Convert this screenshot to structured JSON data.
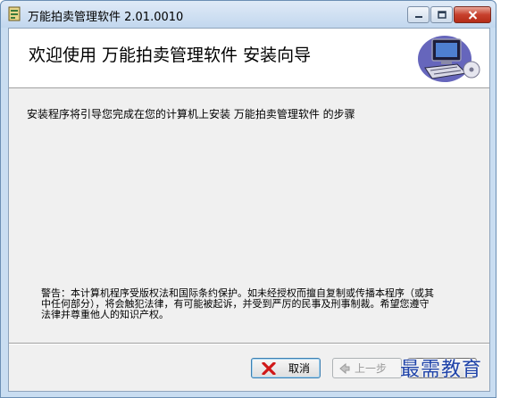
{
  "window": {
    "title": "万能拍卖管理软件 2.01.0010"
  },
  "banner": {
    "title": "欢迎使用 万能拍卖管理软件 安装向导",
    "graphic_icon": "computer-install-icon"
  },
  "body": {
    "intro": "安装程序将引导您完成在您的计算机上安装 万能拍卖管理软件 的步骤",
    "warning_lines": [
      "警告：本计算机程序受版权法和国际条约保护。如未经授权而擅自复制或传播本程序（或其",
      "中任何部分），将会触犯法律，有可能被起诉，并受到严厉的民事及刑事制裁。希望您遵守",
      "法律并尊重他人的知识产权。"
    ]
  },
  "buttons": {
    "cancel_label": "取消",
    "back_label": "上一步"
  },
  "watermark": "最需教育",
  "colors": {
    "title_bar": "#c9ddf1",
    "close_button": "#c7402d",
    "watermark": "#1f43a8"
  }
}
